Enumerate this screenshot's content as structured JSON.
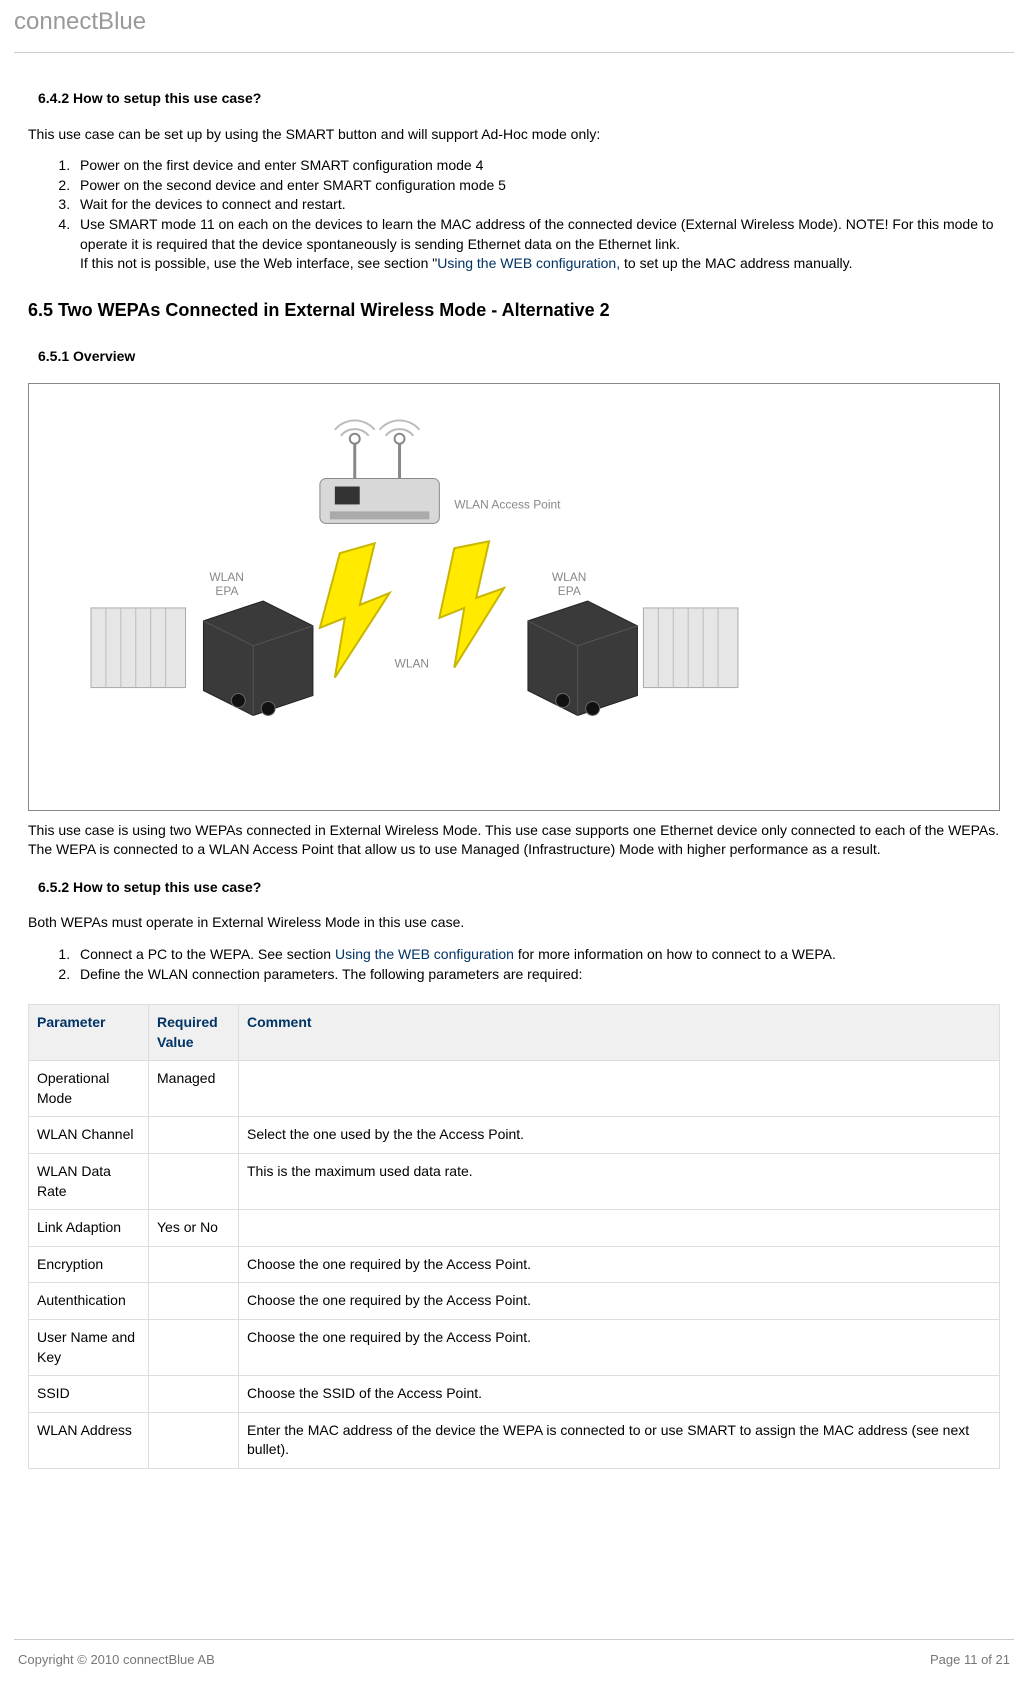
{
  "header": {
    "brand": "connectBlue"
  },
  "s642": {
    "heading": "6.4.2 How to setup this use case?",
    "intro": "This use case can be set up by using the SMART button and will support Ad-Hoc mode only:",
    "steps": [
      "Power on the first device and enter SMART configuration mode 4",
      "Power on the second device and enter SMART configuration mode 5",
      "Wait for the devices to connect and restart."
    ],
    "step4_a": "Use SMART mode 11 on each on the devices to learn the MAC address of the connected device (External Wireless Mode). NOTE! For this mode to operate it is required that the device spontaneously is sending Ethernet data on the Ethernet link.",
    "step4_b_pre": "If this not is possible, use the Web interface, see section \"",
    "step4_link": "Using the WEB configuration,",
    "step4_b_post": " to set up the MAC address manually."
  },
  "s65": {
    "heading": "6.5 Two WEPAs Connected in External Wireless Mode - Alternative 2"
  },
  "s651": {
    "heading": "6.5.1 Overview",
    "diagram": {
      "ap_label": "WLAN Access Point",
      "wlan_epa_left": "WLAN\nEPA",
      "wlan_epa_right": "WLAN\nEPA",
      "wlan_label": "WLAN"
    },
    "desc": "This use case is using two WEPAs connected in External Wireless Mode. This use case supports one Ethernet device only connected to each of the WEPAs. The WEPA is connected to a WLAN Access Point that allow us to use Managed (Infrastructure) Mode with higher performance as a result."
  },
  "s652": {
    "heading": "6.5.2 How to setup this use case?",
    "intro": "Both WEPAs must operate in External Wireless Mode in this use case.",
    "step1_pre": "Connect a PC to the WEPA. See section ",
    "step1_link": "Using the WEB configuration",
    "step1_post": " for more information on how to connect to a WEPA.",
    "step2": "Define the WLAN connection parameters. The following parameters are required:",
    "table": {
      "headers": [
        "Parameter",
        "Required Value",
        "Comment"
      ],
      "rows": [
        {
          "p": "Operational Mode",
          "v": "Managed",
          "c": ""
        },
        {
          "p": "WLAN Channel",
          "v": "",
          "c": "Select the one used by the the Access Point."
        },
        {
          "p": "WLAN Data Rate",
          "v": "",
          "c": "This is the maximum used data rate."
        },
        {
          "p": "Link Adaption",
          "v": "Yes or No",
          "c": ""
        },
        {
          "p": "Encryption",
          "v": "",
          "c": "Choose the one required by the Access Point."
        },
        {
          "p": "Autenthication",
          "v": "",
          "c": "Choose the one required by the Access Point."
        },
        {
          "p": "User Name and Key",
          "v": "",
          "c": "Choose the one required by the Access Point."
        },
        {
          "p": "SSID",
          "v": "",
          "c": "Choose the SSID of the Access Point."
        },
        {
          "p": "WLAN Address",
          "v": "",
          "c": "Enter the MAC address of the device the WEPA is connected to or use SMART to assign the MAC address (see next bullet)."
        }
      ]
    }
  },
  "footer": {
    "copyright": "Copyright © 2010 connectBlue AB",
    "page": "Page 11 of 21"
  }
}
